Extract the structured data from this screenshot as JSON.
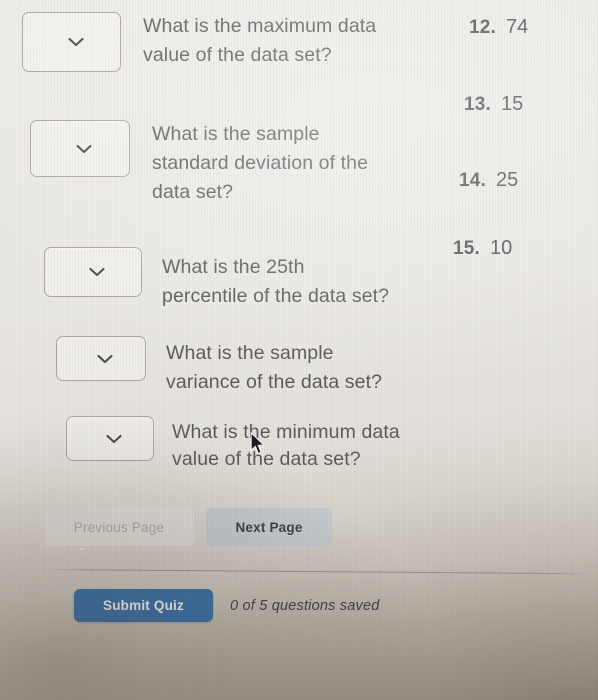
{
  "quiz": {
    "questions": [
      {
        "id": "q-maximum-data-value",
        "dropdown_value": "",
        "text": "What is the maximum data\nvalue of the data set?"
      },
      {
        "id": "q-sample-standard-deviation",
        "dropdown_value": "",
        "text": "What is the sample\nstandard deviation of the\ndata set?"
      },
      {
        "id": "q-25th-percentile",
        "dropdown_value": "",
        "text": "What is the 25th\npercentile of the data set?"
      },
      {
        "id": "q-sample-variance",
        "dropdown_value": "",
        "text": "What is the sample\nvariance of the data set?"
      },
      {
        "id": "q-minimum-data-value",
        "dropdown_value": "",
        "text": "What is the minimum data\nvalue of the data set?"
      }
    ],
    "answer_choices": [
      {
        "number": "12.",
        "value": "74"
      },
      {
        "number": "13.",
        "value": "15"
      },
      {
        "number": "14.",
        "value": "25"
      },
      {
        "number": "15.",
        "value": "10"
      }
    ],
    "navigation": {
      "previous_page_label": "Previous Page",
      "next_page_label": "Next Page"
    },
    "footer": {
      "submit_label": "Submit Quiz",
      "saved_status": "0 of 5 questions saved"
    },
    "icons": {
      "dropdown_chevron": "chevron-down-icon",
      "cursor": "mouse-pointer-icon"
    },
    "colors": {
      "submit_button": "#3a71a8",
      "next_page_button": "#c4cace",
      "previous_page_button": "#dedad6",
      "question_text": "#5c5c5c",
      "page_background": "#e9e7e3"
    }
  }
}
